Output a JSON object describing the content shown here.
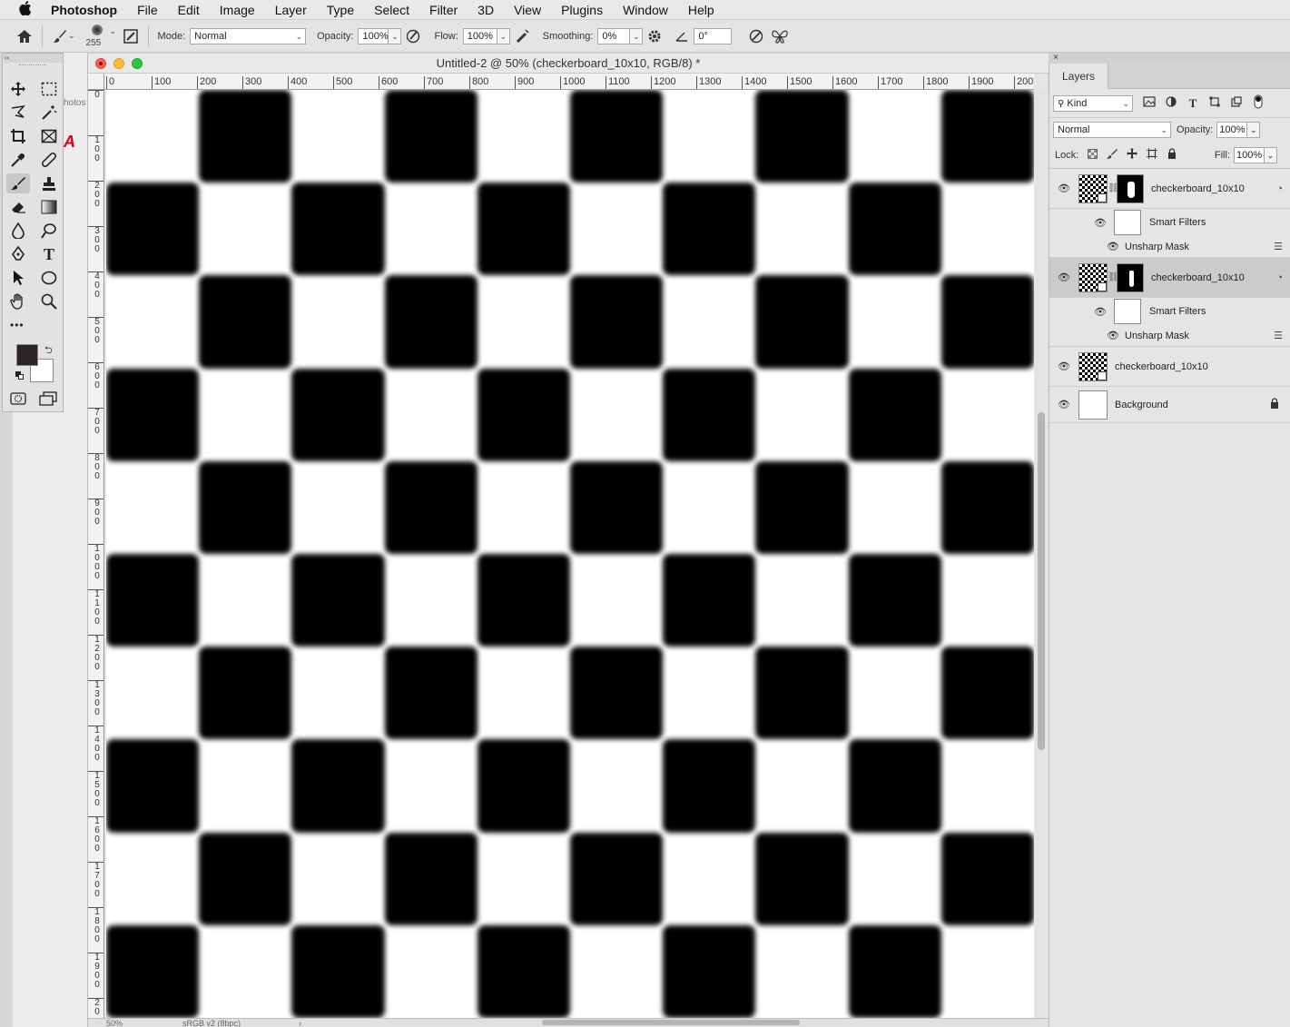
{
  "menubar": {
    "apple_icon": "",
    "app_name": "Photoshop",
    "items": [
      "File",
      "Edit",
      "Image",
      "Layer",
      "Type",
      "Select",
      "Filter",
      "3D",
      "View",
      "Plugins",
      "Window",
      "Help"
    ]
  },
  "options_bar": {
    "brush_size": "255",
    "mode_label": "Mode:",
    "mode_value": "Normal",
    "opacity_label": "Opacity:",
    "opacity_value": "100%",
    "flow_label": "Flow:",
    "flow_value": "100%",
    "smoothing_label": "Smoothing:",
    "smoothing_value": "0%",
    "angle_value": "0°"
  },
  "tools_panel": {
    "collapse_glyph": "‹‹",
    "more_glyph": "•••",
    "foreground_color": "#2a2424",
    "background_color": "#ffffff"
  },
  "background_fragment": "hotos",
  "document": {
    "title": "Untitled-2 @ 50% (checkerboard_10x10, RGB/8) *",
    "h_ruler": [
      "0",
      "100",
      "200",
      "300",
      "400",
      "500",
      "600",
      "700",
      "800",
      "900",
      "1000",
      "1100",
      "1200",
      "1300",
      "1400",
      "1500",
      "1600",
      "1700",
      "1800",
      "1900",
      "200"
    ],
    "v_ruler": [
      "0",
      "1\n0\n0",
      "2\n0\n0",
      "3\n0\n0",
      "4\n0\n0",
      "5\n0\n0",
      "6\n0\n0",
      "7\n0\n0",
      "8\n0\n0",
      "9\n0\n0",
      "1\n0\n0\n0",
      "1\n1\n0\n0",
      "1\n2\n0\n0",
      "1\n3\n0\n0",
      "1\n4\n0\n0",
      "1\n5\n0\n0",
      "1\n6\n0\n0",
      "1\n7\n0\n0",
      "1\n8\n0\n0",
      "1\n9\n0\n0",
      "2\n0"
    ],
    "status_zoom": "50%",
    "status_profile": "sRGB v2 (8bpc)",
    "checkerboard": {
      "rows": 10,
      "cols": 10,
      "first_black": "col-1-row-0"
    }
  },
  "layers_panel": {
    "close_glyph": "×",
    "tab_label": "Layers",
    "filter_kind": "Kind",
    "blend_mode": "Normal",
    "opacity_label": "Opacity:",
    "opacity_value": "100%",
    "lock_label": "Lock:",
    "fill_label": "Fill:",
    "fill_value": "100%",
    "layers": [
      {
        "name": "checkerboard_10x10",
        "type": "smart-object-with-mask",
        "selected": false,
        "smart_filters_label": "Smart Filters",
        "filter_name": "Unsharp Mask"
      },
      {
        "name": "checkerboard_10x10",
        "type": "smart-object-with-mask",
        "selected": true,
        "smart_filters_label": "Smart Filters",
        "filter_name": "Unsharp Mask"
      },
      {
        "name": "checkerboard_10x10",
        "type": "smart-object",
        "selected": false
      },
      {
        "name": "Background",
        "type": "background",
        "selected": false
      }
    ]
  }
}
